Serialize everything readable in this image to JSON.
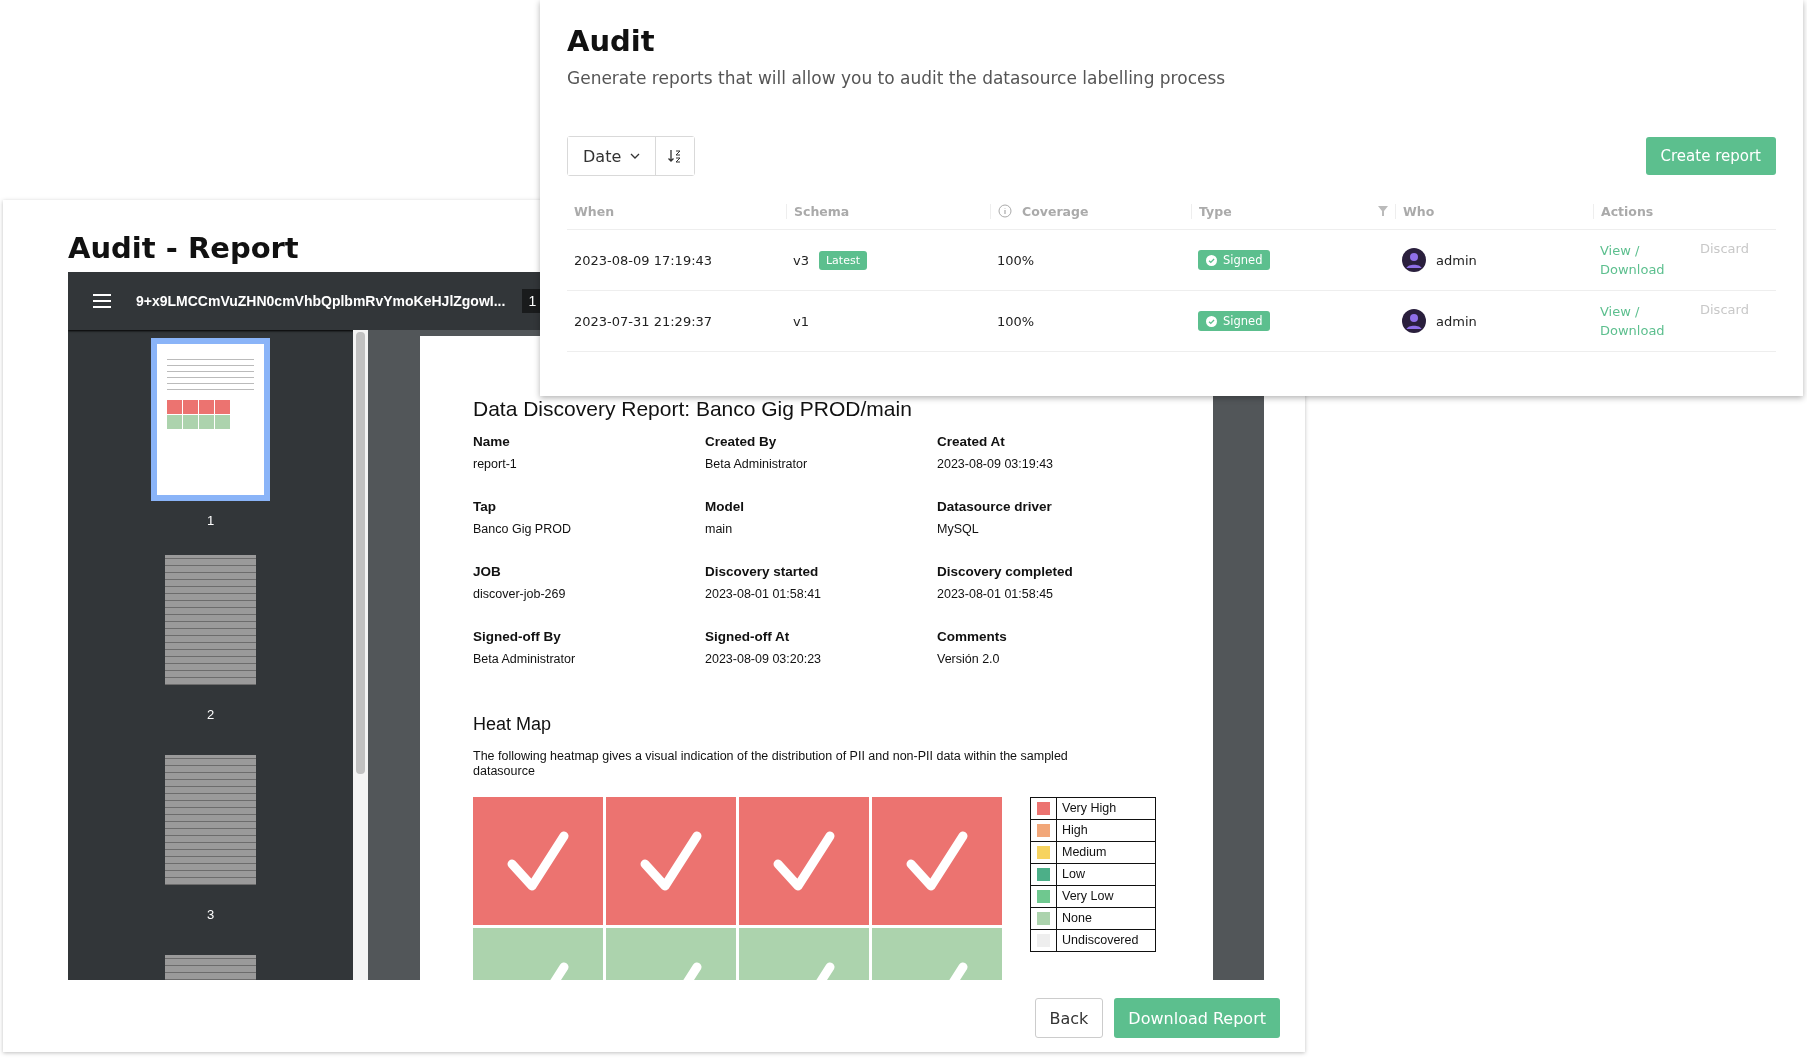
{
  "report_window": {
    "title": "Audit - Report",
    "viewer": {
      "file_name": "9+x9LMCCmVuZHN0cmVhbQplbmRvYmoKeHJlZgowI...",
      "page_number": "1",
      "thumbnails": [
        {
          "label": "1",
          "kind": "summary",
          "selected": true
        },
        {
          "label": "2",
          "kind": "tables",
          "selected": false
        },
        {
          "label": "3",
          "kind": "tables",
          "selected": false
        },
        {
          "kind": "tables",
          "selected": false
        }
      ],
      "page": {
        "title": "Data Discovery Report: Banco Gig PROD/main",
        "fields": [
          {
            "label": "Name",
            "value": "report-1"
          },
          {
            "label": "Created By",
            "value": "Beta Administrator"
          },
          {
            "label": "Created At",
            "value": "2023-08-09 03:19:43"
          },
          {
            "label": "Tap",
            "value": "Banco Gig PROD"
          },
          {
            "label": "Model",
            "value": "main"
          },
          {
            "label": "Datasource driver",
            "value": "MySQL"
          },
          {
            "label": "JOB",
            "value": "discover-job-269"
          },
          {
            "label": "Discovery started",
            "value": "2023-08-01 01:58:41"
          },
          {
            "label": "Discovery completed",
            "value": "2023-08-01 01:58:45"
          },
          {
            "label": "Signed-off By",
            "value": "Beta Administrator"
          },
          {
            "label": "Signed-off At",
            "value": "2023-08-09 03:20:23"
          },
          {
            "label": "Comments",
            "value": "Versión 2.0"
          }
        ],
        "heatmap": {
          "title": "Heat Map",
          "description": "The following heatmap gives a visual indication of the distribution of PII and non-PII data within the sampled datasource",
          "rows": [
            [
              {
                "color": "#ec7370"
              },
              {
                "color": "#ec7370"
              },
              {
                "color": "#ec7370"
              },
              {
                "color": "#ec7370"
              }
            ],
            [
              {
                "color": "#acd3ad"
              },
              {
                "color": "#acd3ad"
              },
              {
                "color": "#acd3ad"
              },
              {
                "color": "#acd3ad"
              }
            ]
          ],
          "legend": [
            {
              "label": "Very High",
              "color": "#ec7370"
            },
            {
              "label": "High",
              "color": "#f2a779"
            },
            {
              "label": "Medium",
              "color": "#f7d35f"
            },
            {
              "label": "Low",
              "color": "#4caf88"
            },
            {
              "label": "Very Low",
              "color": "#6fc88f"
            },
            {
              "label": "None",
              "color": "#acd3ad"
            },
            {
              "label": "Undiscovered",
              "color": "#eeeeee"
            }
          ]
        }
      }
    },
    "buttons": [
      {
        "label": "Back",
        "kind": "secondary"
      },
      {
        "label": "Download Report",
        "kind": "primary"
      }
    ]
  },
  "audit_window": {
    "title": "Audit",
    "subtitle": "Generate reports that will allow you to audit the datasource labelling process",
    "sort_field": "Date",
    "create_button": "Create report",
    "table": {
      "columns": [
        "When",
        "Schema",
        "Coverage",
        "Type",
        "Who",
        "Actions"
      ],
      "rows": [
        {
          "when": "2023-08-09 17:19:43",
          "schema": "v3",
          "badge": "Latest",
          "coverage": "100%",
          "type": "Signed",
          "who": "admin",
          "action": "View / Download",
          "discard": {
            "label": "Discard",
            "disabled": true
          }
        },
        {
          "when": "2023-07-31 21:29:37",
          "schema": "v1",
          "coverage": "100%",
          "type": "Signed",
          "who": "admin",
          "action": "View / Download",
          "discard": {
            "label": "Discard",
            "disabled": true
          }
        }
      ]
    }
  }
}
